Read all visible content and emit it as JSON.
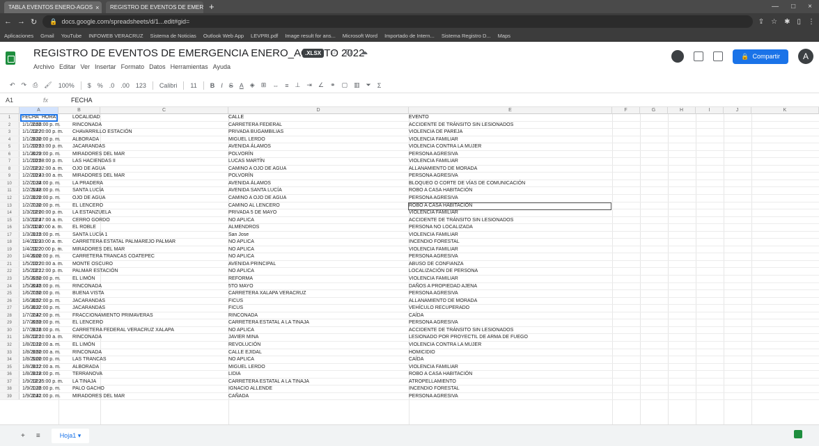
{
  "browser": {
    "tabs": [
      {
        "label": "TABLA EVENTOS ENERO-AGOS",
        "active": false
      },
      {
        "label": "REGISTRO DE EVENTOS DE EMER",
        "active": true
      }
    ],
    "url": "docs.google.com/spreadsheets/d/1...edit#gid=",
    "bookmarks": [
      "Aplicaciones",
      "Gmail",
      "YouTube",
      "INFOWEB VERACRUZ",
      "Sistema de Noticias",
      "Outlook Web App",
      "LEVPRI.pdf",
      "Image result for ans...",
      "Microsoft Word",
      "Importado de Intern...",
      "Sistema Registro D...",
      "Maps"
    ]
  },
  "doc": {
    "title": "REGISTRO DE EVENTOS DE EMERGENCIA ENERO_AGOSTO 2022",
    "format_badge": ".XLSX",
    "menus": [
      "Archivo",
      "Editar",
      "Ver",
      "Insertar",
      "Formato",
      "Datos",
      "Herramientas",
      "Ayuda"
    ],
    "share_label": "Compartir",
    "account_initial": "A"
  },
  "toolbar": {
    "zoom": "100%",
    "font": "Calibri",
    "size": "11",
    "format_number": "123"
  },
  "formula": {
    "namebox": "A1",
    "value": "FECHA"
  },
  "columns": [
    "A",
    "B",
    "C",
    "D",
    "E",
    "F",
    "G",
    "H",
    "I",
    "J",
    "K"
  ],
  "header_row": {
    "fecha": "FECHA",
    "hora": "HORA",
    "localidad": "LOCALIDAD",
    "calle": "CALLE",
    "evento": "EVENTO"
  },
  "rows": [
    {
      "fecha": "1/1/2022",
      "hora": "2:55:00 p. m.",
      "localidad": "RINCONADA",
      "calle": "CARRETERA FEDERAL",
      "evento": "ACCIDENTE DE TRÁNSITO SIN LESIONADOS"
    },
    {
      "fecha": "1/1/2022",
      "hora": "12:20:00 p. m.",
      "localidad": "CHAVARRILLO ESTACIÓN",
      "calle": "PRIVADA BUGAMBILIAS",
      "evento": "VIOLENCIA DE PAREJA"
    },
    {
      "fecha": "1/1/2022",
      "hora": "9:30:00 p. m.",
      "localidad": "ALBORADA",
      "calle": "MIGUEL LERDO",
      "evento": "VIOLENCIA FAMILIAR"
    },
    {
      "fecha": "1/1/2022",
      "hora": "10:53:00 p. m.",
      "localidad": "JACARANDAS",
      "calle": "AVENIDA ÁLAMOS",
      "evento": "VIOLENCIA CONTRA LA MUJER"
    },
    {
      "fecha": "1/1/2022",
      "hora": "8:29:00 p. m.",
      "localidad": "MIRADORES DEL MAR",
      "calle": "POLVORÍN",
      "evento": "PERSONA AGRESIVA"
    },
    {
      "fecha": "1/1/2022",
      "hora": "10:58:00 p. m.",
      "localidad": "LAS HACIENDAS II",
      "calle": "LUCAS MARTÍN",
      "evento": "VIOLENCIA FAMILIAR"
    },
    {
      "fecha": "1/2/2022",
      "hora": "12:32:00 a. m.",
      "localidad": "OJO DE AGUA",
      "calle": "CAMINO A OJO DE AGUA",
      "evento": "ALLANAMIENTO DE MORADA"
    },
    {
      "fecha": "1/2/2022",
      "hora": "10:43:00 a. m.",
      "localidad": "MIRADORES DEL MAR",
      "calle": "POLVORÍN",
      "evento": "PERSONA AGRESIVA"
    },
    {
      "fecha": "1/2/2022",
      "hora": "1:34:00 p. m.",
      "localidad": "LA PRADERA",
      "calle": "AVENIDA ÁLAMOS",
      "evento": "BLOQUEO O CORTE DE VÍAS DE COMUNICACIÓN"
    },
    {
      "fecha": "1/2/2022",
      "hora": "5:48:00 p. m.",
      "localidad": "SANTA LUCÍA",
      "calle": "AVENIDA SANTA LUCÍA",
      "evento": "ROBO A CASA HABITACIÓN"
    },
    {
      "fecha": "1/2/2022",
      "hora": "3:20:00 p. m.",
      "localidad": "OJO DE AGUA",
      "calle": "CAMINO A OJO DE AGUA",
      "evento": "PERSONA AGRESIVA"
    },
    {
      "fecha": "1/2/2022",
      "hora": "7:30:00 p. m.",
      "localidad": "EL LENCERO",
      "calle": "CAMINO AL LENCERO",
      "evento": "ROBO A CASA HABITACIÓN"
    },
    {
      "fecha": "1/3/2022",
      "hora": "12:00:00 p. m.",
      "localidad": "LA ESTANZUELA",
      "calle": "PRIVADA 5 DE MAYO",
      "evento": "VIOLENCIA FAMILIAR"
    },
    {
      "fecha": "1/3/2022",
      "hora": "12:47:00 a. m.",
      "localidad": "CERRO GORDO",
      "calle": "NO APLICA",
      "evento": "ACCIDENTE DE TRÁNSITO SIN LESIONADOS"
    },
    {
      "fecha": "1/3/2022",
      "hora": "11:40:00 a. m.",
      "localidad": "EL ROBLE",
      "calle": "ALMENDROS",
      "evento": "PERSONA NO LOCALIZADA"
    },
    {
      "fecha": "1/3/2022",
      "hora": "3:15:00 p. m.",
      "localidad": "SANTA LUCÍA 1",
      "calle": "San Jose",
      "evento": "VIOLENCIA FAMILIAR"
    },
    {
      "fecha": "1/4/2022",
      "hora": "11:33:00 a. m.",
      "localidad": "CARRETERA ESTATAL PALMAREJO PALMAR",
      "calle": "NO APLICA",
      "evento": "INCENDIO FORESTAL"
    },
    {
      "fecha": "1/4/2022",
      "hora": "11:20:00 p. m.",
      "localidad": "MIRADORES DEL MAR",
      "calle": "NO APLICA",
      "evento": "VIOLENCIA FAMILIAR"
    },
    {
      "fecha": "1/4/2022",
      "hora": "6:00:00 p. m.",
      "localidad": "CARRETERA TRANCAS COATEPEC",
      "calle": "NO APLICA",
      "evento": "PERSONA AGRESIVA"
    },
    {
      "fecha": "1/5/2022",
      "hora": "10:20:00 a. m.",
      "localidad": "MONTE OSCURO",
      "calle": "AVENIDA PRINCIPAL",
      "evento": "ABUSO DE CONFIANZA"
    },
    {
      "fecha": "1/5/2022",
      "hora": "12:12:00 p. m.",
      "localidad": "PALMAR ESTACIÓN",
      "calle": "NO APLICA",
      "evento": "LOCALIZACIÓN DE PERSONA"
    },
    {
      "fecha": "1/5/2022",
      "hora": "6:50:00 p. m.",
      "localidad": "EL LIMÓN",
      "calle": "REFORMA",
      "evento": "VIOLENCIA FAMILIAR"
    },
    {
      "fecha": "1/5/2022",
      "hora": "8:45:00 p. m.",
      "localidad": "RINCONADA",
      "calle": "5TO MAYO",
      "evento": "DAÑOS A PROPIEDAD AJENA"
    },
    {
      "fecha": "1/6/2022",
      "hora": "7:50:00 p. m.",
      "localidad": "BUENA VISTA",
      "calle": "CARRETERA XALAPA VERACRUZ",
      "evento": "PERSONA AGRESIVA"
    },
    {
      "fecha": "1/6/2022",
      "hora": "8:52:00 p. m.",
      "localidad": "JACARANDAS",
      "calle": "FICUS",
      "evento": "ALLANAMIENTO DE MORADA"
    },
    {
      "fecha": "1/6/2022",
      "hora": "8:32:00 p. m.",
      "localidad": "JACARANDAS",
      "calle": "FICUS",
      "evento": "VEHÍCULO RECUPERADO"
    },
    {
      "fecha": "1/7/2022",
      "hora": "2:42:00 p. m.",
      "localidad": "FRACCIONAMIENTO PRIMAVERAS",
      "calle": "RINCONADA",
      "evento": "CAÍDA"
    },
    {
      "fecha": "1/7/2022",
      "hora": "8:59:00 p. m.",
      "localidad": "EL LENCERO",
      "calle": "CARRETERA ESTATAL A LA TINAJA",
      "evento": "PERSONA AGRESIVA"
    },
    {
      "fecha": "1/7/2022",
      "hora": "9:16:00 p. m.",
      "localidad": "CARRETERA FEDERAL VERACRUZ XALAPA",
      "calle": "NO APLICA",
      "evento": "ACCIDENTE DE TRÁNSITO SIN LESIONADOS"
    },
    {
      "fecha": "1/8/2022",
      "hora": "12:10:00 a. m.",
      "localidad": "RINCONADA",
      "calle": "JAVIER MINA",
      "evento": "LESIONADO POR PROYECTIL DE ARMA DE FUEGO"
    },
    {
      "fecha": "1/8/2022",
      "hora": "1:10:00 a. m.",
      "localidad": "EL LIMÓN",
      "calle": "REVOLUCIÓN",
      "evento": "VIOLENCIA CONTRA LA MUJER"
    },
    {
      "fecha": "1/8/2022",
      "hora": "9:50:00 a. m.",
      "localidad": "RINCONADA",
      "calle": "CALLE EJIDAL",
      "evento": "HOMICIDIO"
    },
    {
      "fecha": "1/8/2022",
      "hora": "5:00:00 p. m.",
      "localidad": "LAS TRANCAS",
      "calle": "NO APLICA",
      "evento": "CAÍDA"
    },
    {
      "fecha": "1/8/2022",
      "hora": "9:12:00 a. m.",
      "localidad": "ALBORADA",
      "calle": "MIGUEL LERDO",
      "evento": "VIOLENCIA FAMILIAR"
    },
    {
      "fecha": "1/8/2022",
      "hora": "9:18:00 p. m.",
      "localidad": "TERRANOVA",
      "calle": "LIDIA",
      "evento": "ROBO A CASA HABITACIÓN"
    },
    {
      "fecha": "1/9/2022",
      "hora": "12:35:00 p. m.",
      "localidad": "LA TINAJA",
      "calle": "CARRETERA ESTATAL A LA TINAJA",
      "evento": "ATROPELLAMIENTO"
    },
    {
      "fecha": "1/9/2022",
      "hora": "1:35:00 p. m.",
      "localidad": "PALO GACHO",
      "calle": "IGNACIO ALLENDE",
      "evento": "INCENDIO FORESTAL"
    },
    {
      "fecha": "1/9/2022",
      "hora": "2:41:00 p. m.",
      "localidad": "MIRADORES DEL MAR",
      "calle": "CAÑADA",
      "evento": "PERSONA AGRESIVA"
    }
  ],
  "bottom": {
    "sheet_tab": "Hoja1"
  }
}
